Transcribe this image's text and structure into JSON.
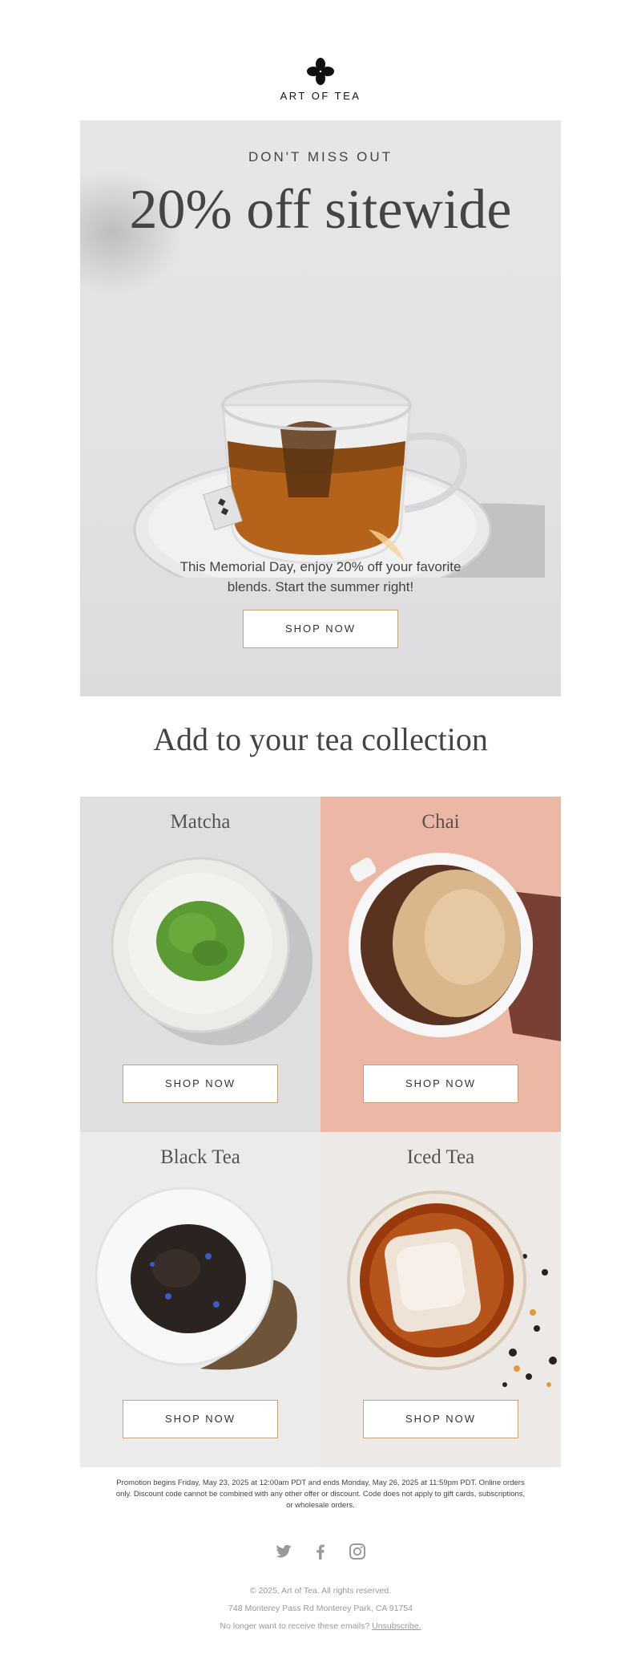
{
  "header": {
    "brand": "ART OF TEA"
  },
  "hero": {
    "eyebrow": "DON'T MISS OUT",
    "title": "20% off sitewide",
    "body": "This Memorial Day, enjoy 20% off your favorite blends. Start the summer right!",
    "cta": "SHOP NOW"
  },
  "collection": {
    "heading": "Add to your tea collection",
    "items": [
      {
        "name": "Matcha",
        "cta": "SHOP NOW"
      },
      {
        "name": "Chai",
        "cta": "SHOP NOW"
      },
      {
        "name": "Black Tea",
        "cta": "SHOP NOW"
      },
      {
        "name": "Iced Tea",
        "cta": "SHOP NOW"
      }
    ]
  },
  "disclaimer": "Promotion begins Friday, May 23, 2025 at 12:00am PDT and ends Monday, May 26, 2025 at 11:59pm PDT. Online orders only. Discount code cannot be combined with any other offer or discount. Code does not apply to gift cards, subscriptions, or wholesale orders.",
  "social": [
    "twitter-icon",
    "facebook-icon",
    "instagram-icon"
  ],
  "footer": {
    "copyright": "© 2025, Art of Tea. All rights reserved.",
    "address": "748 Monterey Pass Rd Monterey Park, CA 91754",
    "unsubscribe_prompt": "No longer want to receive these emails?",
    "unsubscribe_link": "Unsubscribe."
  },
  "colors": {
    "button_border": "#c3a379",
    "chai_bg": "#ecb7a4",
    "hero_bg": "#e4e4e6"
  }
}
